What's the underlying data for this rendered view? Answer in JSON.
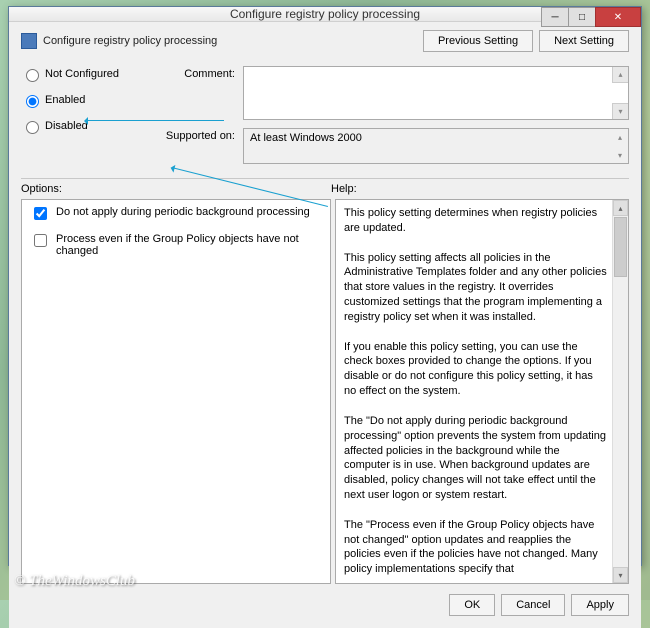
{
  "titlebar": {
    "title": "Configure registry policy processing"
  },
  "header": {
    "label": "Configure registry policy processing"
  },
  "nav": {
    "previous": "Previous Setting",
    "next": "Next Setting"
  },
  "state": {
    "not_configured": "Not Configured",
    "enabled": "Enabled",
    "disabled": "Disabled",
    "selected": "enabled"
  },
  "form": {
    "comment_label": "Comment:",
    "comment_value": "",
    "supported_label": "Supported on:",
    "supported_value": "At least Windows 2000"
  },
  "labels": {
    "options": "Options:",
    "help": "Help:"
  },
  "options": {
    "items": [
      {
        "label": "Do not apply during periodic background processing",
        "checked": true
      },
      {
        "label": "Process even if the Group Policy objects have not changed",
        "checked": false
      }
    ]
  },
  "help": {
    "text": "This policy setting determines when registry policies are updated.\n\nThis policy setting affects all policies in the Administrative Templates folder and any other policies that store values in the registry. It overrides customized settings that the program implementing a registry policy set when it was installed.\n\nIf you enable this policy setting, you can use the check boxes provided to change the options. If you disable or do not configure this policy setting, it has no effect on the system.\n\nThe \"Do not apply during periodic background processing\" option prevents the system from updating affected policies in the background while the computer is in use. When background updates are disabled, policy changes will not take effect until the next user logon or system restart.\n\nThe \"Process even if the Group Policy objects have not changed\" option updates and reapplies the policies even if the policies have not changed. Many policy implementations specify that"
  },
  "footer": {
    "ok": "OK",
    "cancel": "Cancel",
    "apply": "Apply"
  },
  "watermark": "© TheWindowsClub"
}
